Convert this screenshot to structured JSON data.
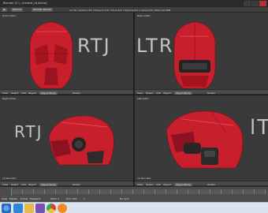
{
  "window": {
    "title": "Blender [C:\\...\\helmet_rtj.blend]"
  },
  "topbar": {
    "editor": "Default",
    "engine": "Blender Render",
    "info": "v2.79 | Verts:2,720 | Faces:2,712 | Tris:5,427 | Objects:0/9 | Lamps:0/0 | Mem:26.98M"
  },
  "viewports": [
    {
      "name": "Front Ortho",
      "footer": "(1) Bev.001"
    },
    {
      "name": "Back Ortho",
      "footer": "(1) Bev.001"
    },
    {
      "name": "Right Ortho",
      "footer": "(1) Bev.001"
    },
    {
      "name": "Left Ortho",
      "footer": "(1) Bev.001"
    }
  ],
  "header_bar": {
    "view": "View",
    "select": "Select",
    "add": "Add",
    "object": "Object",
    "mode": "Object Mode",
    "orientation": "Global"
  },
  "reference_text": {
    "rtj": "RTJ",
    "rtj_mirror": "LTR",
    "rtj_side": "RTJ",
    "lt": "lT"
  },
  "timeline": {
    "view": "View",
    "marker": "Marker",
    "frame": "Frame",
    "playback": "Playback",
    "start": "Start: 1",
    "end": "End: 250",
    "current": "1",
    "sync": "No Sync"
  },
  "colors": {
    "helmet_red": "#c81f2d",
    "panel": "#3a3a3a",
    "header": "#4a4a4a"
  },
  "taskbar": {
    "icons": [
      "windows-start-icon",
      "internet-explorer-icon",
      "folder-icon",
      "visual-studio-icon",
      "chrome-icon",
      "blender-icon"
    ]
  }
}
